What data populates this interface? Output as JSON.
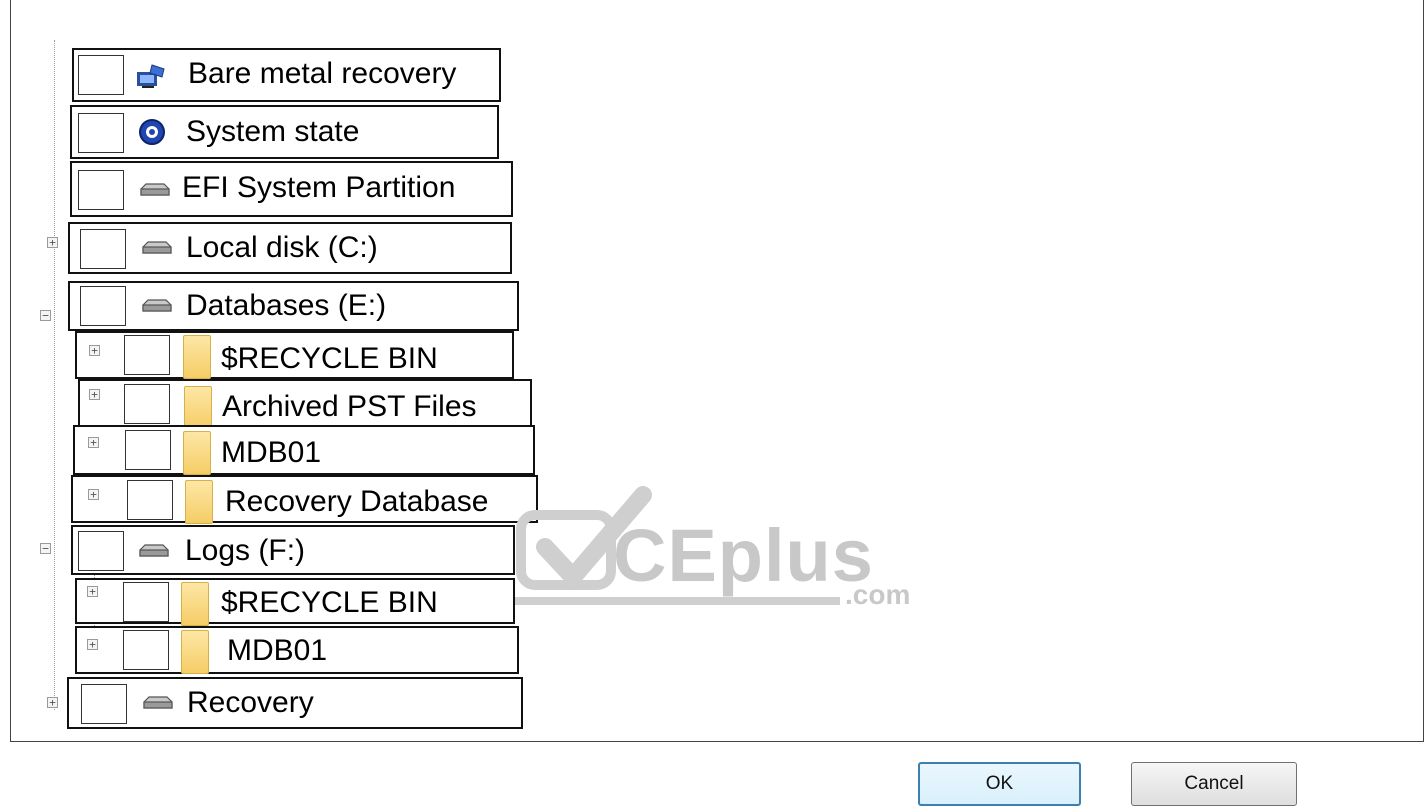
{
  "tree": {
    "items": [
      {
        "label": "Bare metal recovery",
        "icon": "bare-metal-icon"
      },
      {
        "label": "System state",
        "icon": "system-state-icon"
      },
      {
        "label": "EFI System Partition",
        "icon": "drive-icon"
      },
      {
        "label": "Local disk (C:)",
        "icon": "drive-icon"
      },
      {
        "label": "Databases (E:)",
        "icon": "drive-icon"
      },
      {
        "label": "$RECYCLE BIN",
        "icon": "folder-icon"
      },
      {
        "label": "Archived PST Files",
        "icon": "folder-icon"
      },
      {
        "label": "MDB01",
        "icon": "folder-icon"
      },
      {
        "label": "Recovery Database",
        "icon": "folder-icon"
      },
      {
        "label": "Logs (F:)",
        "icon": "drive-icon"
      },
      {
        "label": "$RECYCLE BIN",
        "icon": "folder-icon"
      },
      {
        "label": "MDB01",
        "icon": "folder-icon"
      },
      {
        "label": "Recovery",
        "icon": "drive-icon"
      }
    ]
  },
  "buttons": {
    "ok_label": "OK",
    "cancel_label": "Cancel"
  },
  "watermark": {
    "brand": "CEplus",
    "suffix": ".com"
  }
}
